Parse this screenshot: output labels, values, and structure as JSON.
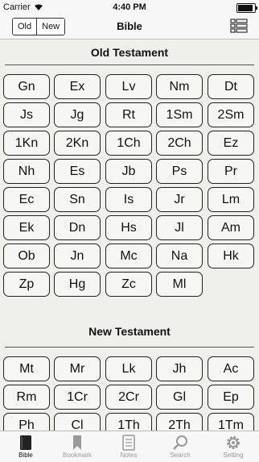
{
  "status": {
    "carrier": "Carrier",
    "time": "4:40 PM"
  },
  "nav": {
    "old_label": "Old",
    "new_label": "New",
    "title": "Bible"
  },
  "old_testament": {
    "title": "Old Testament",
    "books": [
      "Gn",
      "Ex",
      "Lv",
      "Nm",
      "Dt",
      "Js",
      "Jg",
      "Rt",
      "1Sm",
      "2Sm",
      "1Kn",
      "2Kn",
      "1Ch",
      "2Ch",
      "Ez",
      "Nh",
      "Es",
      "Jb",
      "Ps",
      "Pr",
      "Ec",
      "Sn",
      "Is",
      "Jr",
      "Lm",
      "Ek",
      "Dn",
      "Hs",
      "Jl",
      "Am",
      "Ob",
      "Jn",
      "Mc",
      "Na",
      "Hk",
      "Zp",
      "Hg",
      "Zc",
      "Ml"
    ]
  },
  "new_testament": {
    "title": "New Testament",
    "books": [
      "Mt",
      "Mr",
      "Lk",
      "Jh",
      "Ac",
      "Rm",
      "1Cr",
      "2Cr",
      "Gl",
      "Ep",
      "Ph",
      "Cl",
      "1Th",
      "2Th",
      "1Tm"
    ]
  },
  "tabs": [
    {
      "label": "Bible",
      "icon": "book-icon",
      "active": true
    },
    {
      "label": "Bookmark",
      "icon": "bookmark-icon",
      "active": false
    },
    {
      "label": "Notes",
      "icon": "notes-icon",
      "active": false
    },
    {
      "label": "Search",
      "icon": "search-icon",
      "active": false
    },
    {
      "label": "Setting",
      "icon": "gear-icon",
      "active": false
    }
  ]
}
